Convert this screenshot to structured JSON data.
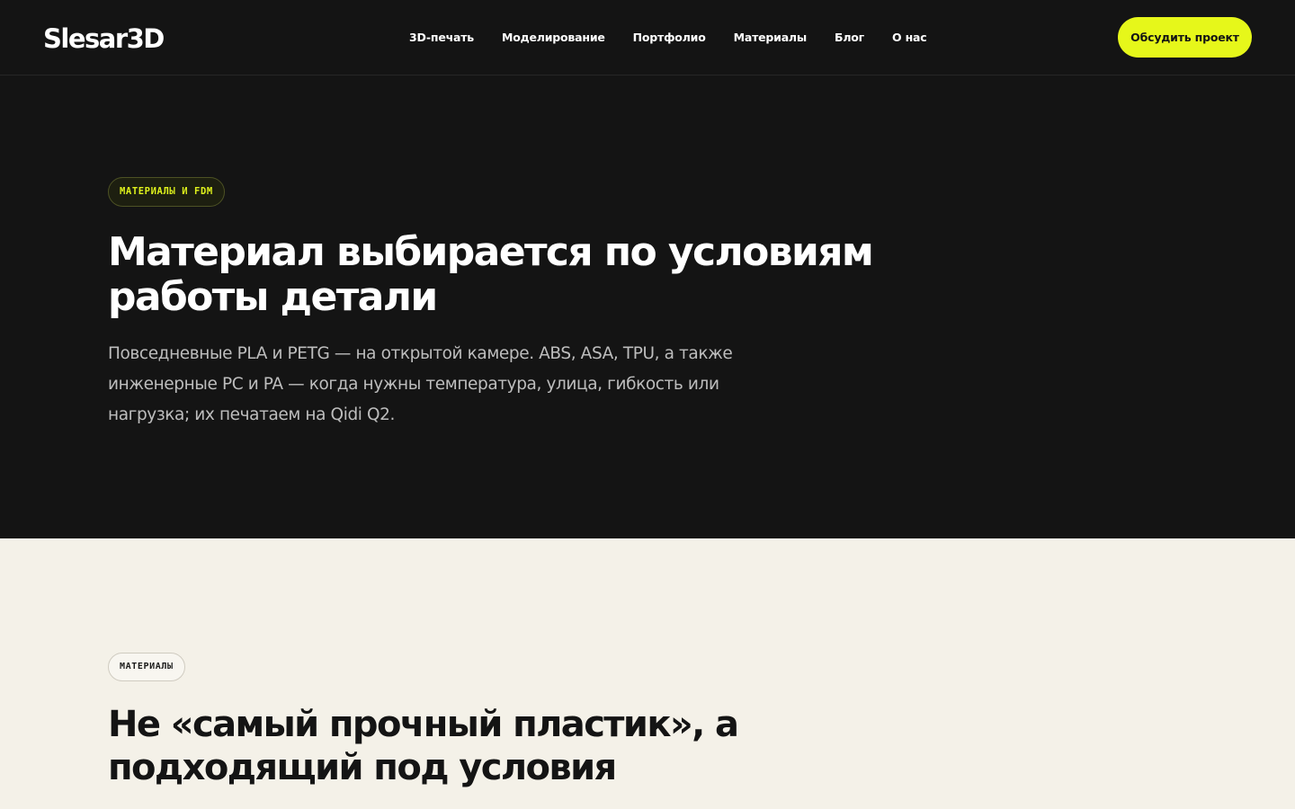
{
  "header": {
    "logo": "Slesar3D",
    "nav": [
      {
        "label": "3D-печать"
      },
      {
        "label": "Моделирование"
      },
      {
        "label": "Портфолио"
      },
      {
        "label": "Материалы"
      },
      {
        "label": "Блог"
      },
      {
        "label": "О нас"
      }
    ],
    "cta_label": "Обсудить проект"
  },
  "hero": {
    "badge": "МАТЕРИАЛЫ И FDM",
    "title": "Материал выбирается по условиям работы детали",
    "lead": "Повседневные PLA и PETG — на открытой камере. ABS, ASA, TPU, а также инженерные PC и PA — когда нужны температура, улица, гибкость или нагрузка; их печатаем на Qidi Q2."
  },
  "materials_section": {
    "badge": "МАТЕРИАЛЫ",
    "title": "Не «самый прочный пластик», а подходящий под условия"
  },
  "colors": {
    "dark_background": "#141414",
    "light_background": "#f4f1e8",
    "accent": "#e6f71a"
  }
}
